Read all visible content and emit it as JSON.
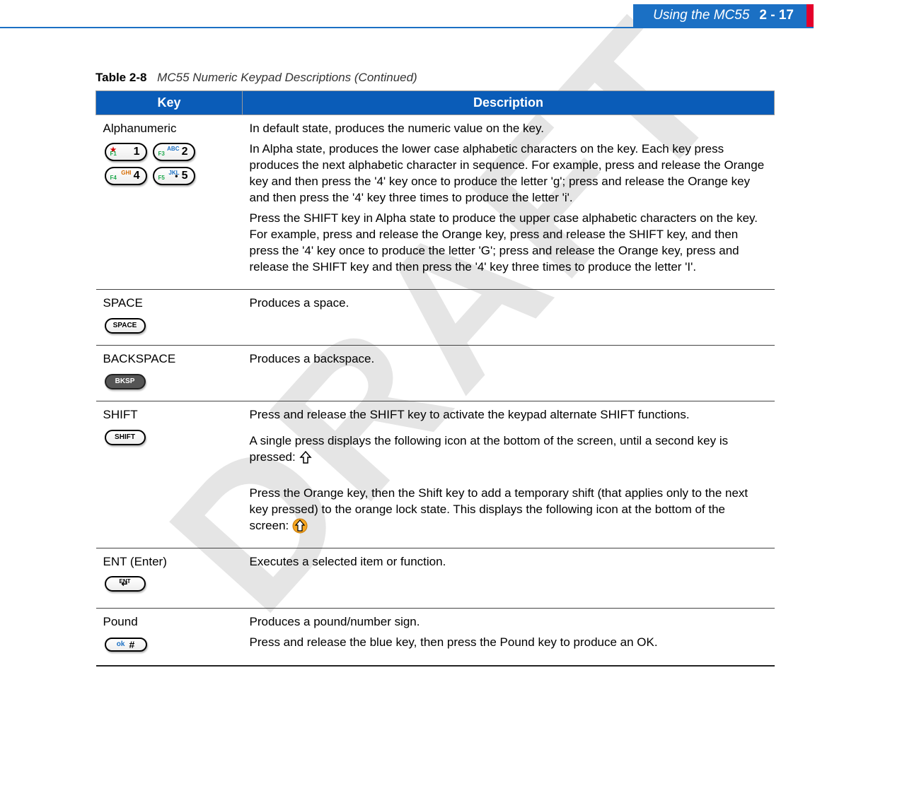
{
  "header": {
    "section_title": "Using the MC55",
    "page_number": "2 - 17"
  },
  "watermark": "DRAFT",
  "caption": {
    "table_number": "Table 2-8",
    "title": "MC55 Numeric Keypad Descriptions (Continued)"
  },
  "columns": {
    "key": "Key",
    "description": "Description"
  },
  "rows": {
    "alphanumeric": {
      "name": "Alphanumeric",
      "keys": [
        {
          "sym": "★",
          "fn": "F1",
          "alpha": "",
          "digit": "1"
        },
        {
          "sym": "",
          "fn": "F3",
          "alpha": "ABC",
          "digit": "2"
        },
        {
          "sym": "",
          "fn": "F4",
          "alpha": "GHI",
          "digit": "4"
        },
        {
          "sym": "",
          "fn": "F5",
          "alpha": "JKL",
          "digit": "5",
          "dot": "•"
        }
      ],
      "desc": [
        "In default state, produces the numeric value on the key.",
        "In Alpha state, produces the lower case alphabetic characters on the key. Each key press produces the next alphabetic character in sequence. For example, press and release the Orange key and then press the '4' key once to produce the letter 'g'; press and release the Orange key and then press the '4' key three times to produce the letter 'i'.",
        "Press the SHIFT key in Alpha state to produce the upper case alphabetic characters on the key. For example, press and release the Orange key, press and release the SHIFT key, and then press the '4' key once to produce the letter 'G'; press and release the Orange key, press and release the SHIFT key and then press the '4' key three times to produce the letter 'I'."
      ]
    },
    "space": {
      "name": "SPACE",
      "key_label": "SPACE",
      "desc": [
        "Produces a space."
      ]
    },
    "backspace": {
      "name": "BACKSPACE",
      "key_label": "BKSP",
      "desc": [
        "Produces a backspace."
      ]
    },
    "shift": {
      "name": "SHIFT",
      "key_label": "SHIFT",
      "desc1": "Press and release the SHIFT key to activate the keypad alternate SHIFT functions.",
      "desc2": "A single press displays the following icon at the bottom of the screen, until a second key is pressed:",
      "desc3": "Press the Orange key, then the Shift key to add a temporary shift (that applies only to the next key pressed) to the orange lock state. This displays the following icon at the bottom of the screen:"
    },
    "ent": {
      "name": "ENT (Enter)",
      "key_label": "ENT",
      "desc": [
        "Executes a selected item or function."
      ]
    },
    "pound": {
      "name": "Pound",
      "ok_label": "ok",
      "hash_label": "#",
      "desc": [
        "Produces a pound/number sign.",
        "Press and release the blue key, then press the Pound key to produce an OK."
      ]
    }
  }
}
